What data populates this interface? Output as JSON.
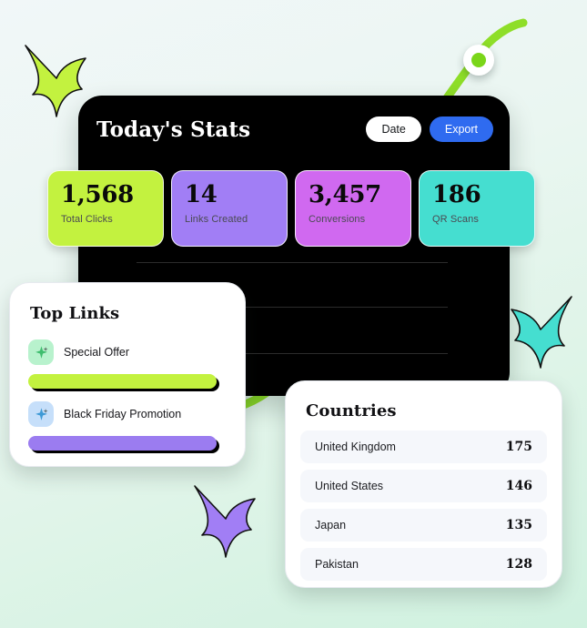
{
  "background": {
    "top_color": "#f1f7f8",
    "bottom_color": "#cff1df"
  },
  "dashboard": {
    "title": "Today's Stats",
    "panel_color": "#000000",
    "actions": [
      {
        "label": "Date",
        "name": "date-button",
        "bg": "#ffffff",
        "fg": "#15171a"
      },
      {
        "label": "Export",
        "name": "export-button",
        "bg": "#2f6bf0",
        "fg": "#ffffff"
      }
    ],
    "stats": [
      {
        "value": "1,568",
        "label": "Total Clicks",
        "color": "#c3f23f"
      },
      {
        "value": "14",
        "label": "Links Created",
        "color": "#a17ef5"
      },
      {
        "value": "3,457",
        "label": "Conversions",
        "color": "#d069f0"
      },
      {
        "value": "186",
        "label": "QR Scans",
        "color": "#45ded0"
      }
    ]
  },
  "trend_curve": {
    "color": "#8ede28",
    "marker_ring": "#ffffff",
    "marker_dot": "#7ad619"
  },
  "top_links": {
    "title": "Top Links",
    "items": [
      {
        "name": "Special Offer",
        "icon": "sparkle-icon",
        "icon_bg": "#b8f2cd",
        "icon_fg": "#3fbd6e",
        "bar_color": "#c3f23f",
        "bar_percent": 95
      },
      {
        "name": "Black Friday Promotion",
        "icon": "sparkle-icon",
        "icon_bg": "#c6dffa",
        "icon_fg": "#3f9ad6",
        "bar_color": "#9b7cf0",
        "bar_percent": 95
      }
    ]
  },
  "countries": {
    "title": "Countries",
    "rows": [
      {
        "name": "United Kingdom",
        "count": "175"
      },
      {
        "name": "United States",
        "count": "146"
      },
      {
        "name": "Japan",
        "count": "135"
      },
      {
        "name": "Pakistan",
        "count": "128"
      }
    ]
  },
  "decorations": {
    "sparkles": [
      {
        "name": "sparkle-green",
        "color": "#c3f23f"
      },
      {
        "name": "sparkle-teal",
        "color": "#45ded0"
      },
      {
        "name": "sparkle-purple",
        "color": "#a17ef5"
      }
    ]
  }
}
